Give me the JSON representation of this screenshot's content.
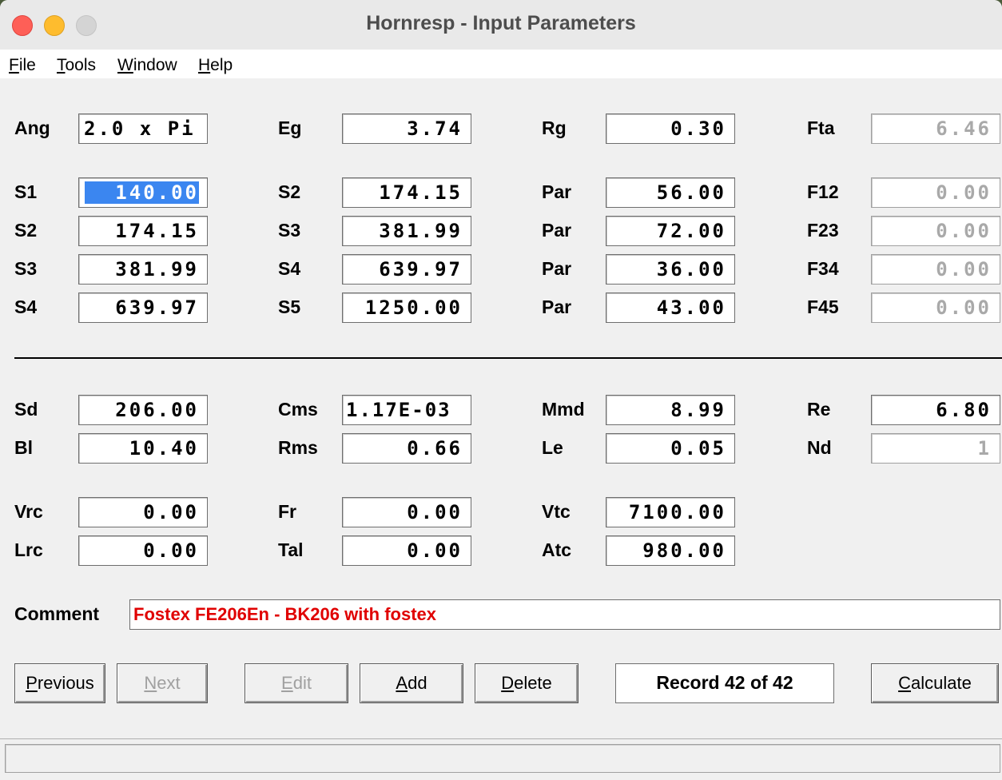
{
  "window": {
    "title": "Hornresp - Input Parameters"
  },
  "menu": {
    "items": [
      "File",
      "Tools",
      "Window",
      "Help"
    ]
  },
  "params": {
    "ang": {
      "label": "Ang",
      "value": "2.0 x Pi"
    },
    "eg": {
      "label": "Eg",
      "value": "3.74"
    },
    "rg": {
      "label": "Rg",
      "value": "0.30"
    },
    "fta": {
      "label": "Fta",
      "value": "6.46"
    },
    "row_s1": {
      "label": "S1",
      "value": "140.00"
    },
    "row_s1_s2": {
      "label": "S2",
      "value": "174.15"
    },
    "row_s1_par": {
      "label": "Par",
      "value": "56.00"
    },
    "f12": {
      "label": "F12",
      "value": "0.00"
    },
    "row_s2": {
      "label": "S2",
      "value": "174.15"
    },
    "row_s2_s3": {
      "label": "S3",
      "value": "381.99"
    },
    "row_s2_par": {
      "label": "Par",
      "value": "72.00"
    },
    "f23": {
      "label": "F23",
      "value": "0.00"
    },
    "row_s3": {
      "label": "S3",
      "value": "381.99"
    },
    "row_s3_s4": {
      "label": "S4",
      "value": "639.97"
    },
    "row_s3_par": {
      "label": "Par",
      "value": "36.00"
    },
    "f34": {
      "label": "F34",
      "value": "0.00"
    },
    "row_s4": {
      "label": "S4",
      "value": "639.97"
    },
    "row_s4_s5": {
      "label": "S5",
      "value": "1250.00"
    },
    "row_s4_par": {
      "label": "Par",
      "value": "43.00"
    },
    "f45": {
      "label": "F45",
      "value": "0.00"
    },
    "sd": {
      "label": "Sd",
      "value": "206.00"
    },
    "cms": {
      "label": "Cms",
      "value": "1.17E-03"
    },
    "mmd": {
      "label": "Mmd",
      "value": "8.99"
    },
    "re": {
      "label": "Re",
      "value": "6.80"
    },
    "bl": {
      "label": "Bl",
      "value": "10.40"
    },
    "rms": {
      "label": "Rms",
      "value": "0.66"
    },
    "le": {
      "label": "Le",
      "value": "0.05"
    },
    "nd": {
      "label": "Nd",
      "value": "1"
    },
    "vrc": {
      "label": "Vrc",
      "value": "0.00"
    },
    "fr": {
      "label": "Fr",
      "value": "0.00"
    },
    "vtc": {
      "label": "Vtc",
      "value": "7100.00"
    },
    "lrc": {
      "label": "Lrc",
      "value": "0.00"
    },
    "tal": {
      "label": "Tal",
      "value": "0.00"
    },
    "atc": {
      "label": "Atc",
      "value": "980.00"
    }
  },
  "comment": {
    "label": "Comment",
    "value": "Fostex FE206En - BK206 with fostex",
    "color": "#e00000"
  },
  "buttons": {
    "previous": "Previous",
    "next": "Next",
    "edit": "Edit",
    "add": "Add",
    "delete": "Delete",
    "calculate": "Calculate"
  },
  "record": "Record 42 of 42",
  "colors": {
    "selection": "#3b86f0",
    "close": "#fe5f57",
    "minimize": "#febc2e"
  }
}
